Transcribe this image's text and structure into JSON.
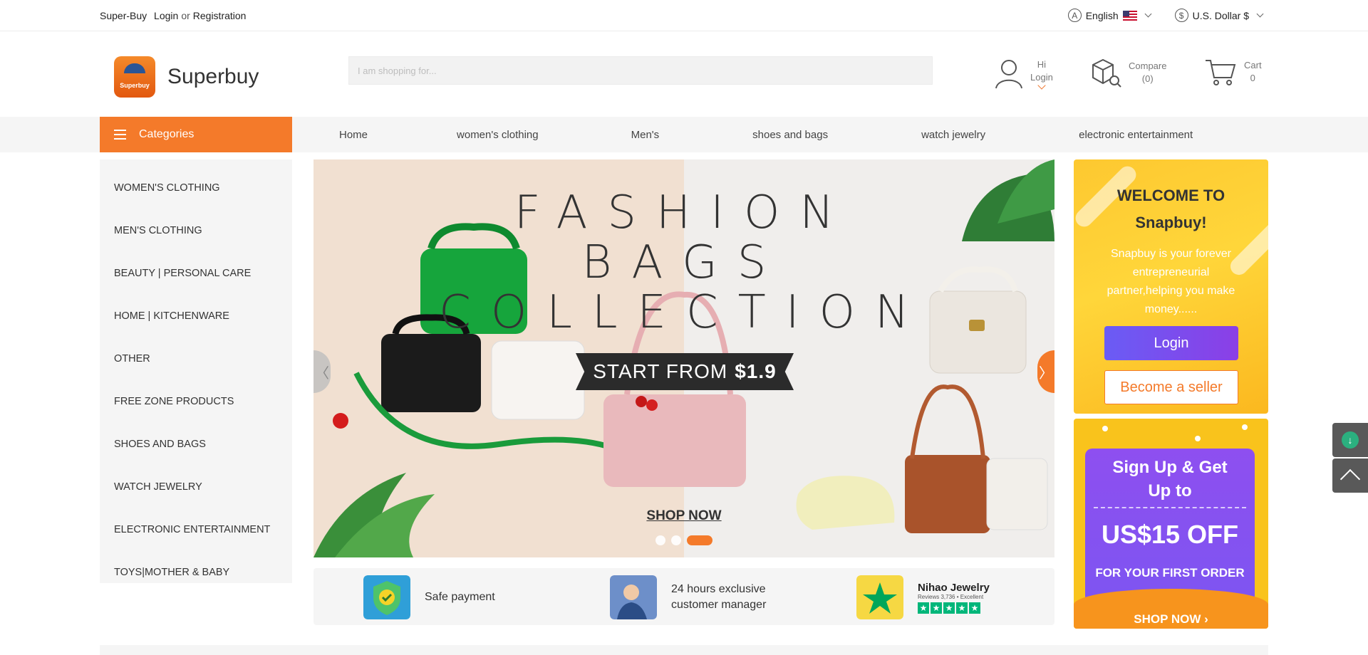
{
  "topbar": {
    "site_name": "Super-Buy",
    "login": "Login",
    "or": "or",
    "registration": "Registration",
    "language": "English",
    "currency": "U.S. Dollar $"
  },
  "header": {
    "brand": "Superbuy",
    "logo_text": "Superbuy",
    "search_placeholder": "I am shopping for...",
    "user": {
      "hi": "Hi",
      "login": "Login"
    },
    "compare": {
      "label": "Compare",
      "count": "(0)"
    },
    "cart": {
      "label": "Cart",
      "count": "0"
    }
  },
  "nav": {
    "categories_label": "Categories",
    "links": [
      "Home",
      "women's clothing",
      "Men's",
      "shoes and bags",
      "watch jewelry",
      "electronic entertainment"
    ]
  },
  "sidebar": {
    "items": [
      "WOMEN'S CLOTHING",
      "MEN'S CLOTHING",
      "BEAUTY | PERSONAL CARE",
      "HOME | KITCHENWARE",
      "OTHER",
      "FREE ZONE PRODUCTS",
      "SHOES AND BAGS",
      "WATCH JEWELRY",
      "ELECTRONIC ENTERTAINMENT",
      "TOYS|MOTHER & BABY"
    ]
  },
  "banner": {
    "line1": "FASHION",
    "line2": "BAGS",
    "line3": "COLLECTION",
    "start_from": "START FROM",
    "price": "$1.9",
    "shop_now": "SHOP NOW",
    "slide_count": 3,
    "active_slide": 3
  },
  "features": {
    "safe_payment": "Safe payment",
    "manager_line1": "24 hours exclusive",
    "manager_line2": "customer manager",
    "trustpilot_name": "Nihao Jewelry",
    "trustpilot_sub": "Reviews 3,736  •  Excellent"
  },
  "welcome": {
    "title_line1": "WELCOME TO",
    "title_line2": "Snapbuy!",
    "description": "Snapbuy is your forever entrepreneurial partner,helping you make money......",
    "login_button": "Login",
    "seller_button": "Become a seller"
  },
  "promo": {
    "line1": "Sign Up & Get",
    "line2": "Up to",
    "amount": "US$15 OFF",
    "line3": "FOR YOUR FIRST ORDER",
    "shop_now": "SHOP NOW ›"
  },
  "colors": {
    "accent": "#f47a2a",
    "login_gradient_start": "#6a5cf5",
    "login_gradient_end": "#8b3fe6",
    "trustpilot": "#00b67a"
  },
  "icons": [
    "language-icon",
    "us-flag-icon",
    "dollar-icon",
    "user-icon",
    "compare-icon",
    "cart-icon",
    "hamburger-icon",
    "download-app-icon",
    "back-to-top-icon"
  ]
}
